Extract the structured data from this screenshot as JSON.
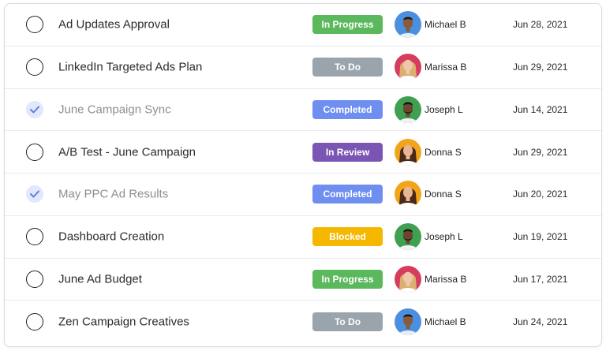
{
  "colors": {
    "In Progress": "#5cb85c",
    "To Do": "#9aa4ad",
    "Completed": "#6e8ef0",
    "In Review": "#7b55b3",
    "Blocked": "#f5b700"
  },
  "avatars": {
    "Michael B": {
      "bg": "#4a8fe0",
      "skin": "#8a5a3c",
      "hair": "#1d1410",
      "shirt": "#e8eef6",
      "style": "short"
    },
    "Marissa B": {
      "bg": "#d63c5e",
      "skin": "#f0c7a8",
      "hair": "#d9b070",
      "shirt": "#ffffff",
      "style": "long"
    },
    "Joseph L": {
      "bg": "#3fa052",
      "skin": "#6e4630",
      "hair": "#1b120c",
      "shirt": "#f2f2f2",
      "style": "beard"
    },
    "Donna S": {
      "bg": "#f2a51a",
      "skin": "#e8b595",
      "hair": "#4a2a18",
      "shirt": "#ffffff",
      "style": "long"
    }
  },
  "tasks": [
    {
      "done": false,
      "name": "Ad Updates Approval",
      "status": "In Progress",
      "person": "Michael B",
      "date": "Jun 28, 2021"
    },
    {
      "done": false,
      "name": "LinkedIn Targeted Ads Plan",
      "status": "To Do",
      "person": "Marissa B",
      "date": "Jun 29, 2021"
    },
    {
      "done": true,
      "name": "June Campaign Sync",
      "status": "Completed",
      "person": "Joseph L",
      "date": "Jun 14, 2021"
    },
    {
      "done": false,
      "name": "A/B Test - June Campaign",
      "status": "In Review",
      "person": "Donna S",
      "date": "Jun 29, 2021"
    },
    {
      "done": true,
      "name": "May PPC Ad Results",
      "status": "Completed",
      "person": "Donna S",
      "date": "Jun 20, 2021"
    },
    {
      "done": false,
      "name": "Dashboard Creation",
      "status": "Blocked",
      "person": "Joseph L",
      "date": "Jun 19, 2021"
    },
    {
      "done": false,
      "name": "June Ad Budget",
      "status": "In Progress",
      "person": "Marissa B",
      "date": "Jun 17, 2021"
    },
    {
      "done": false,
      "name": "Zen Campaign Creatives",
      "status": "To Do",
      "person": "Michael B",
      "date": "Jun 24, 2021"
    }
  ]
}
